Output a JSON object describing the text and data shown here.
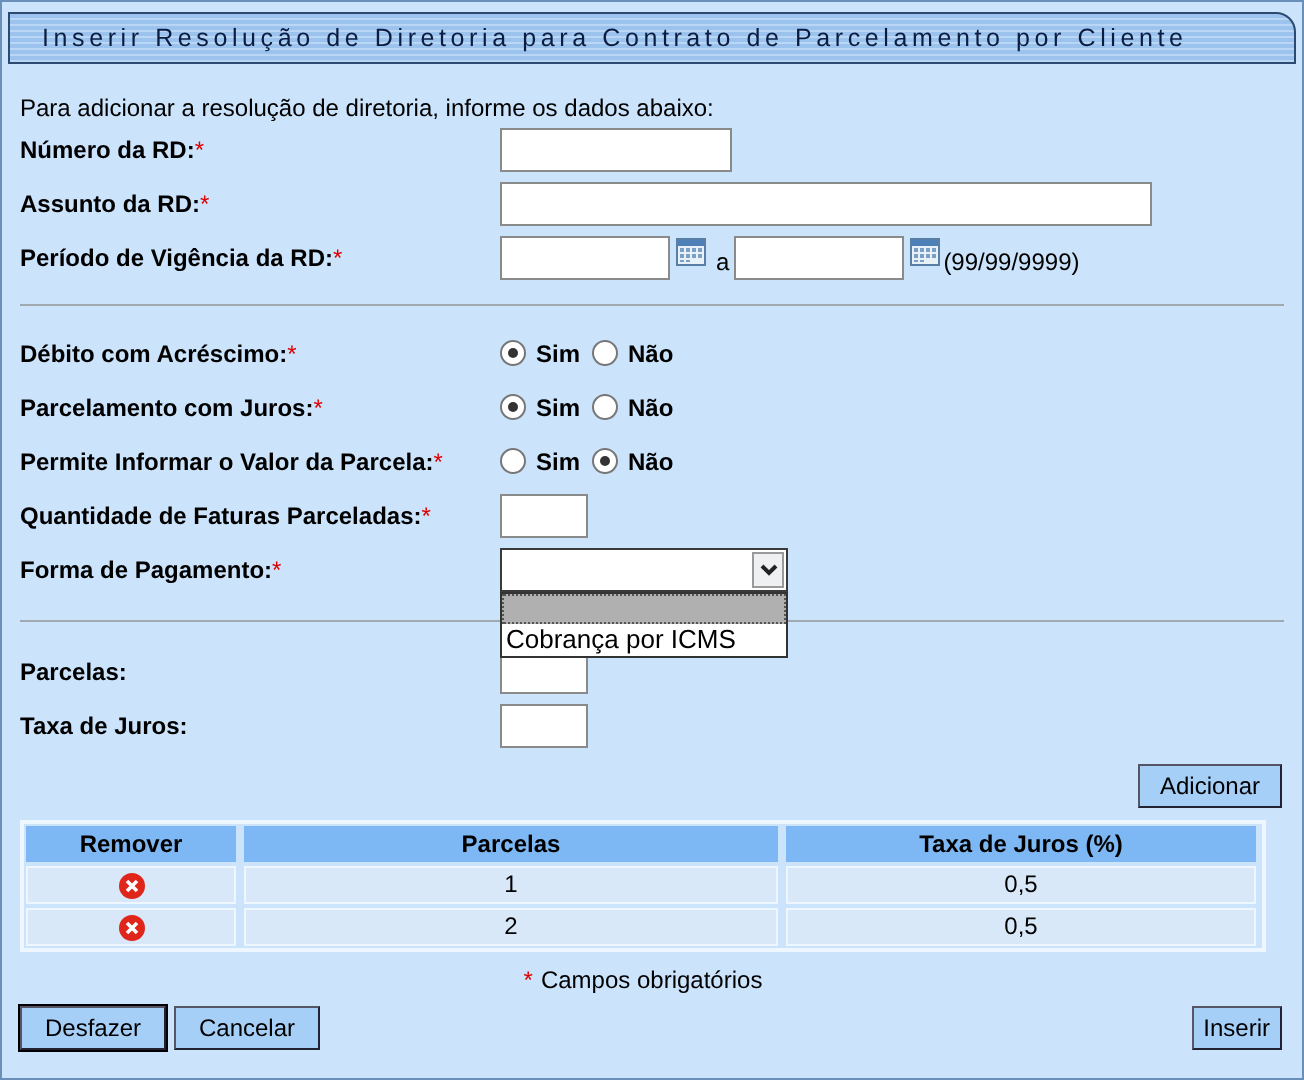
{
  "window": {
    "title": "Inserir Resolução de Diretoria para Contrato de Parcelamento por Cliente"
  },
  "intro": "Para adicionar a resolução de diretoria, informe os dados abaixo:",
  "section_1": [
    {
      "kind": "short_text",
      "label": "Número da RD:",
      "mark": "*"
    },
    {
      "kind": "long_text",
      "label": "Assunto da RD:",
      "mark": "*"
    },
    {
      "kind": "date_range",
      "label": "Período de Vigência da RD:",
      "mark": "*",
      "separator": "a",
      "hint": "(99/99/9999)"
    }
  ],
  "section_2": [
    {
      "kind": "radio",
      "label": "Débito com Acréscimo:",
      "mark": "*",
      "options": [
        {
          "label": "Sim",
          "selected": true
        },
        {
          "label": "Não",
          "selected": false
        }
      ]
    },
    {
      "kind": "radio",
      "label": "Parcelamento com Juros:",
      "mark": "*",
      "options": [
        {
          "label": "Sim",
          "selected": true
        },
        {
          "label": "Não",
          "selected": false
        }
      ]
    },
    {
      "kind": "radio",
      "label": "Permite Informar o Valor da Parcela:",
      "mark": "*",
      "options": [
        {
          "label": "Sim",
          "selected": false
        },
        {
          "label": "Não",
          "selected": true
        }
      ]
    },
    {
      "kind": "tiny_text",
      "label": "Quantidade de Faturas Parceladas:",
      "mark": "*"
    },
    {
      "kind": "select",
      "label": "Forma de Pagamento:",
      "mark": "*",
      "expanded": true,
      "options": [
        "Cobrança por ICMS"
      ]
    }
  ],
  "section_3": [
    {
      "kind": "tiny_text",
      "label": "Parcelas:"
    },
    {
      "kind": "tiny_text",
      "label": "Taxa de Juros:"
    }
  ],
  "add_button": "Adicionar",
  "table": {
    "columns": [
      "Remover",
      "Parcelas",
      "Taxa de Juros (%)"
    ],
    "rows": [
      {
        "parcelas": "1",
        "taxa": "0,5"
      },
      {
        "parcelas": "2",
        "taxa": "0,5"
      }
    ]
  },
  "footnote": {
    "mark": "*",
    "text": "Campos obrigatórios"
  },
  "buttons_left": [
    "Desfazer",
    "Cancelar"
  ],
  "buttons_right": [
    "Inserir"
  ]
}
